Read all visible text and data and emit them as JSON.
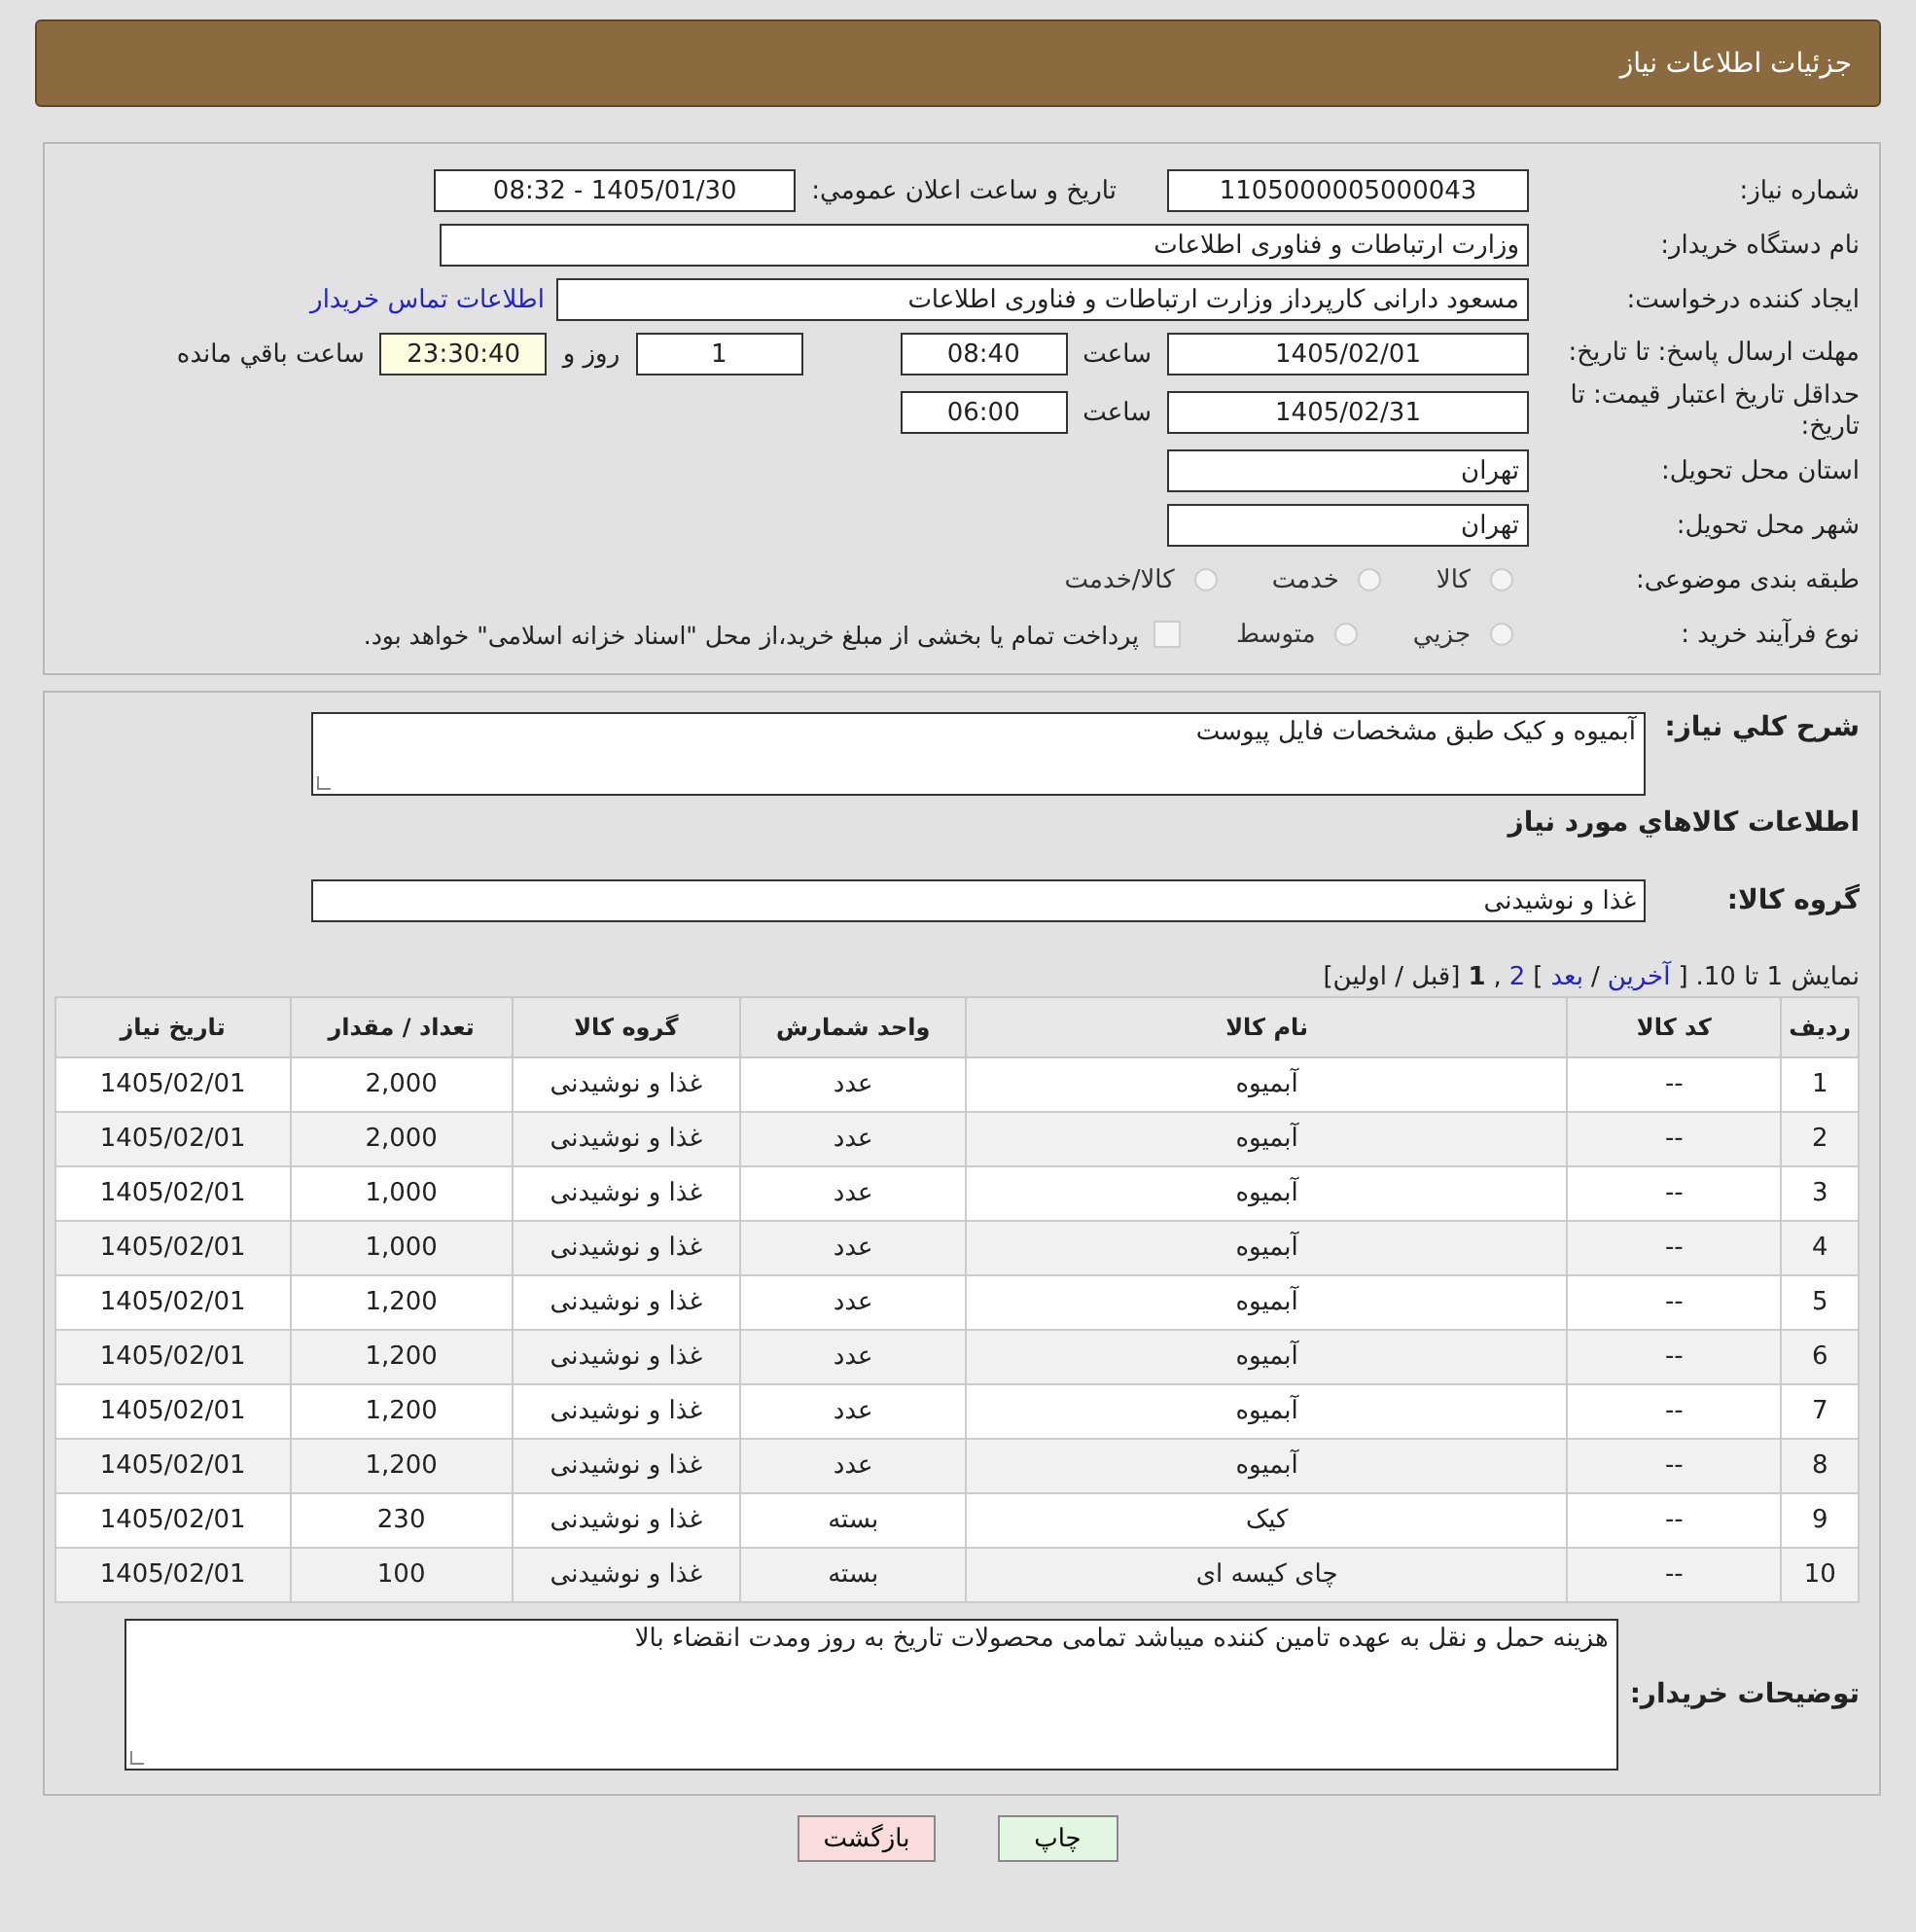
{
  "header": {
    "title": "جزئيات اطلاعات نياز"
  },
  "need_number": {
    "label": "شماره نياز:",
    "value": "1105000005000043"
  },
  "announce": {
    "label": "تاريخ و ساعت اعلان عمومي:",
    "value": "1405/01/30 - 08:32"
  },
  "buyer": {
    "label": "نام دستگاه خريدار:",
    "value": "وزارت ارتباطات و فناوری اطلاعات"
  },
  "requester": {
    "label": "ايجاد کننده درخواست:",
    "value": "مسعود دارانی کارپرداز وزارت ارتباطات و فناوری اطلاعات",
    "link": "اطلاعات تماس خريدار"
  },
  "deadline": {
    "label": "مهلت ارسال پاسخ: تا تاريخ:",
    "date": "1405/02/01",
    "time_label": "ساعت",
    "time": "08:40",
    "days": "1",
    "days_label": "روز و",
    "remaining": "23:30:40",
    "remaining_label": "ساعت باقي مانده"
  },
  "price_validity": {
    "label": "حداقل تاريخ اعتبار قيمت: تا تاريخ:",
    "date": "1405/02/31",
    "time_label": "ساعت",
    "time": "06:00"
  },
  "province": {
    "label": "استان محل تحويل:",
    "value": "تهران"
  },
  "city": {
    "label": "شهر محل تحويل:",
    "value": "تهران"
  },
  "category": {
    "label": "طبقه بندی موضوعی:",
    "options": [
      {
        "label": "کالا",
        "selected": false
      },
      {
        "label": "خدمت",
        "selected": false
      },
      {
        "label": "کالا/خدمت",
        "selected": false
      }
    ]
  },
  "process": {
    "label": "نوع فرآيند خريد :",
    "options": [
      {
        "label": "جزيي",
        "selected": false
      },
      {
        "label": "متوسط",
        "selected": false
      }
    ],
    "treasury": {
      "label": "پرداخت تمام يا بخشی از مبلغ خريد،از محل \"اسناد خزانه اسلامی\" خواهد بود.",
      "checked": false
    }
  },
  "description": {
    "label": "شرح کلي نياز:",
    "value": "آبمیوه و کیک  طبق مشخصات فایل پیوست"
  },
  "goods_title": "اطلاعات کالاهاي مورد نياز",
  "goods_group": {
    "label": "گروه کالا:",
    "value": "غذا و نوشیدنی"
  },
  "pagination": [
    {
      "text": "نمایش 1 تا 10.",
      "kind": "text"
    },
    {
      "text": "[",
      "kind": "text"
    },
    {
      "text": "آخرین",
      "kind": "link"
    },
    {
      "text": "/",
      "kind": "text"
    },
    {
      "text": "بعد",
      "kind": "link"
    },
    {
      "text": "]",
      "kind": "text"
    },
    {
      "text": "2",
      "kind": "link"
    },
    {
      "text": ",",
      "kind": "text"
    },
    {
      "text": "1",
      "kind": "current"
    },
    {
      "text": "[قبل / اولین]",
      "kind": "text"
    }
  ],
  "table": {
    "columns": [
      "رديف",
      "کد کالا",
      "نام کالا",
      "واحد شمارش",
      "گروه کالا",
      "تعداد / مقدار",
      "تاريخ نياز"
    ],
    "rows": [
      [
        "1",
        "--",
        "آبمیوه",
        "عدد",
        "غذا و نوشیدنی",
        "2,000",
        "1405/02/01"
      ],
      [
        "2",
        "--",
        "آبمیوه",
        "عدد",
        "غذا و نوشیدنی",
        "2,000",
        "1405/02/01"
      ],
      [
        "3",
        "--",
        "آبمیوه",
        "عدد",
        "غذا و نوشیدنی",
        "1,000",
        "1405/02/01"
      ],
      [
        "4",
        "--",
        "آبمیوه",
        "عدد",
        "غذا و نوشیدنی",
        "1,000",
        "1405/02/01"
      ],
      [
        "5",
        "--",
        "آبمیوه",
        "عدد",
        "غذا و نوشیدنی",
        "1,200",
        "1405/02/01"
      ],
      [
        "6",
        "--",
        "آبمیوه",
        "عدد",
        "غذا و نوشیدنی",
        "1,200",
        "1405/02/01"
      ],
      [
        "7",
        "--",
        "آبمیوه",
        "عدد",
        "غذا و نوشیدنی",
        "1,200",
        "1405/02/01"
      ],
      [
        "8",
        "--",
        "آبمیوه",
        "عدد",
        "غذا و نوشیدنی",
        "1,200",
        "1405/02/01"
      ],
      [
        "9",
        "--",
        "کیک",
        "بسته",
        "غذا و نوشیدنی",
        "230",
        "1405/02/01"
      ],
      [
        "10",
        "--",
        "چای کیسه ای",
        "بسته",
        "غذا و نوشیدنی",
        "100",
        "1405/02/01"
      ]
    ]
  },
  "buyer_notes": {
    "label": "توضيحات خريدار:",
    "value": "هزینه حمل و نقل به عهده تامین کننده میباشد تمامی محصولات تاریخ به روز ومدت انقضاء بالا"
  },
  "buttons": [
    {
      "label": "چاپ",
      "kind": "print"
    },
    {
      "label": "بازگشت",
      "kind": "back"
    }
  ]
}
